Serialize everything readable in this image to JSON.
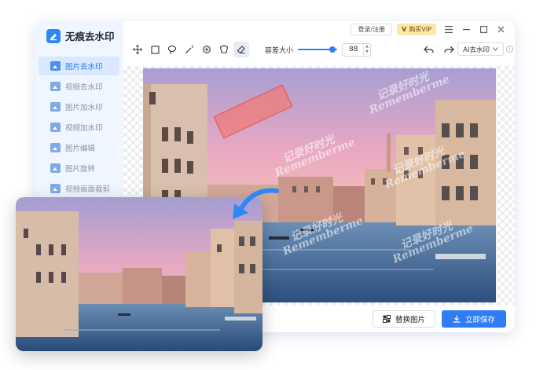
{
  "app": {
    "name": "无痕去水印"
  },
  "sidebar": {
    "items": [
      {
        "label": "图片去水印",
        "active": true
      },
      {
        "label": "视频去水印",
        "active": false
      },
      {
        "label": "图片加水印",
        "active": false
      },
      {
        "label": "视频加水印",
        "active": false
      },
      {
        "label": "图片编辑",
        "active": false
      },
      {
        "label": "图片旋转",
        "active": false
      },
      {
        "label": "视频画面裁剪",
        "active": false
      }
    ]
  },
  "topbar": {
    "login_label": "登录/注册",
    "vip_mark": "V",
    "vip_label": "购买VIP"
  },
  "toolbar": {
    "tolerance_label": "容差大小",
    "tolerance_value": "88",
    "ai_mode_label": "AI去水印",
    "info_glyph": "i"
  },
  "watermark": {
    "text_cn": "记录好时光",
    "text_en": "Rememberme"
  },
  "actions": {
    "replace_label": "替换图片",
    "save_label": "立即保存"
  },
  "colors": {
    "accent": "#2e7cf6",
    "sidebar_bg": "#f0f6ff",
    "vip_bg": "#fce9a6",
    "selection_fill": "#f07b78"
  }
}
